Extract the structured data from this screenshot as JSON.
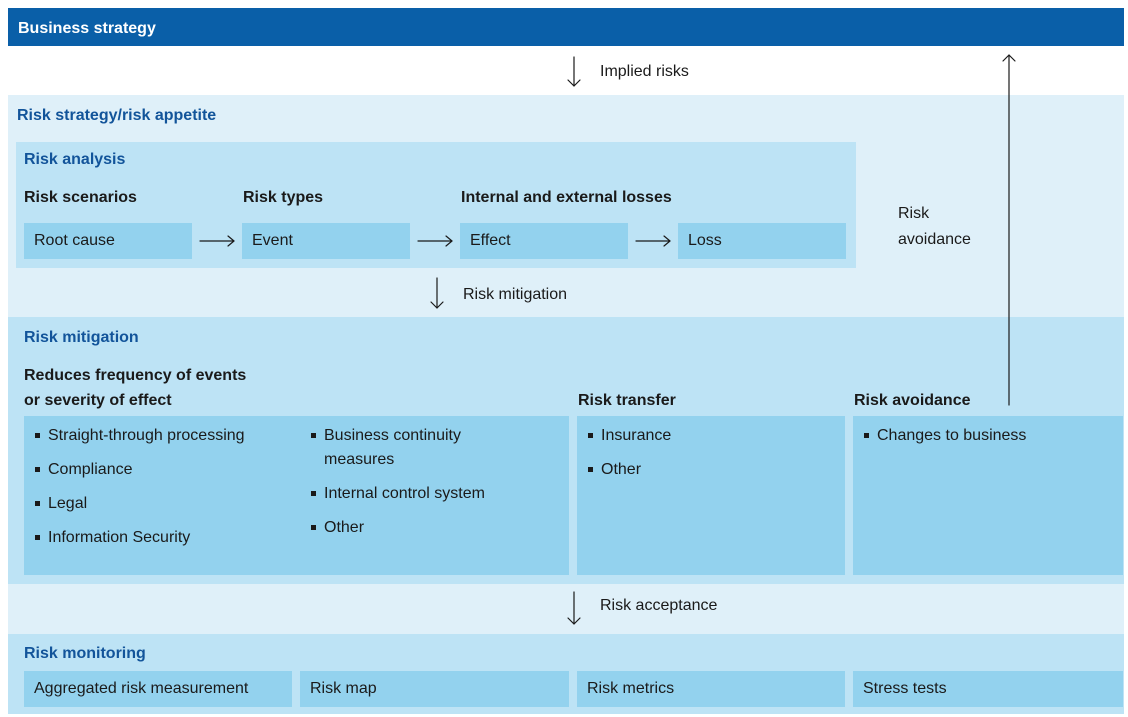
{
  "header": {
    "title": "Business strategy"
  },
  "implied_risks": "Implied risks",
  "risk_strategy": {
    "title": "Risk strategy/risk appetite"
  },
  "risk_analysis": {
    "title": "Risk analysis",
    "col_headers": [
      "Risk scenarios",
      "Risk types",
      "Internal and external losses"
    ],
    "chain": [
      "Root cause",
      "Event",
      "Effect",
      "Loss"
    ]
  },
  "risk_avoidance_arrow": {
    "line1": "Risk",
    "line2": "avoidance"
  },
  "risk_mitigation_arrow": "Risk mitigation",
  "risk_mitigation": {
    "title": "Risk mitigation",
    "reduces": {
      "title_line1": "Reduces frequency of events",
      "title_line2": "or severity of effect",
      "left_items": [
        "Straight-through processing",
        "Compliance",
        "Legal",
        "Information Security"
      ],
      "right_items": [
        "Business continuity measures",
        "Internal control system",
        "Other"
      ]
    },
    "transfer": {
      "title": "Risk transfer",
      "items": [
        "Insurance",
        "Other"
      ]
    },
    "avoidance": {
      "title": "Risk avoidance",
      "items": [
        "Changes to business"
      ]
    }
  },
  "risk_acceptance": "Risk acceptance",
  "risk_monitoring": {
    "title": "Risk monitoring",
    "items": [
      "Aggregated risk measurement",
      "Risk map",
      "Risk metrics",
      "Stress tests"
    ]
  },
  "colors": {
    "header_blue": "#0a5fa8",
    "title_blue": "#12549a",
    "light_band": "#dff0f9",
    "mid_band": "#bde3f5",
    "dark_box": "#93d2ee"
  }
}
